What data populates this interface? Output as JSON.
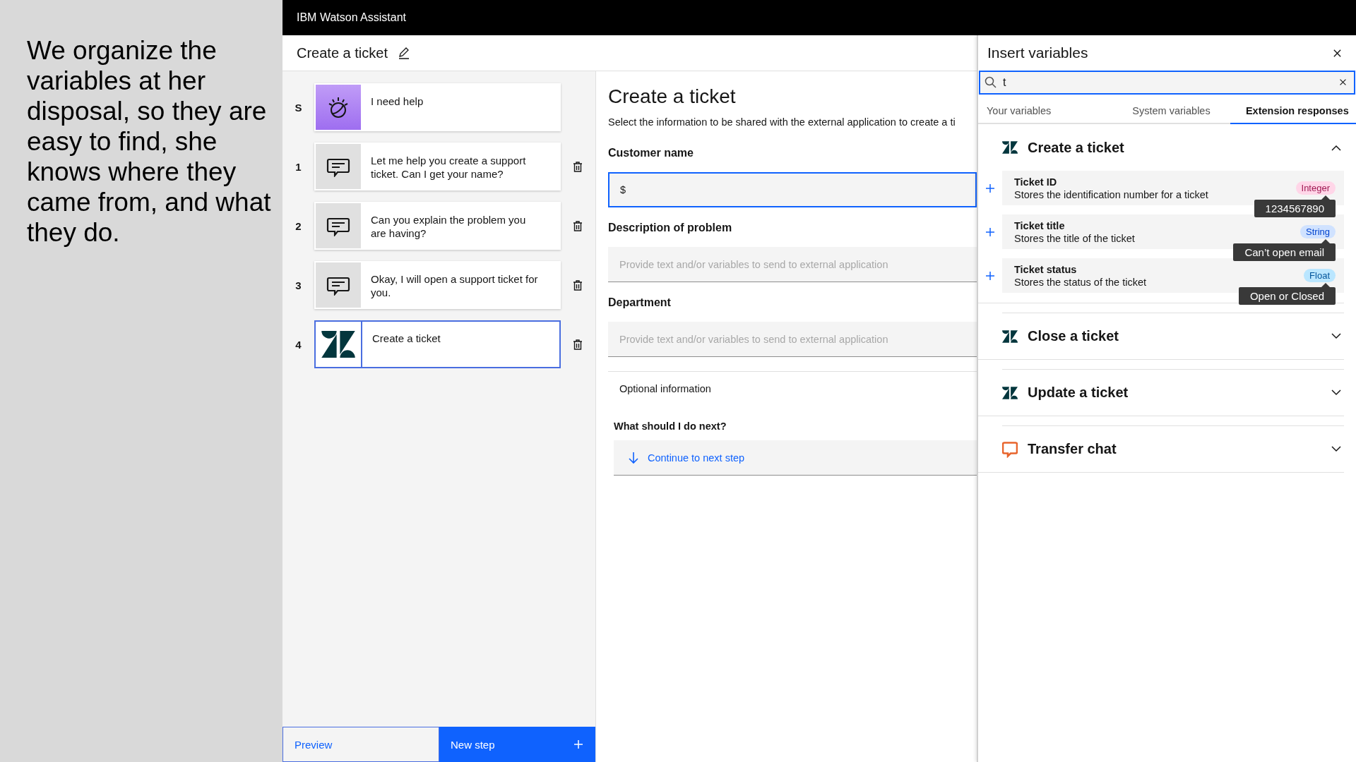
{
  "caption": "We organize the variables at her disposal, so they are easy to find, she knows where they came from, and what they do.",
  "app_bar": {
    "title": "IBM Watson Assistant"
  },
  "action_header": {
    "title": "Create a ticket"
  },
  "steps": [
    {
      "marker": "S",
      "kind": "trigger",
      "text": "I need help",
      "selected": false
    },
    {
      "marker": "1",
      "kind": "message",
      "text": "Let me help you create a support ticket. Can I get your name?",
      "selected": false
    },
    {
      "marker": "2",
      "kind": "message",
      "text": "Can you explain the problem you are having?",
      "selected": false
    },
    {
      "marker": "3",
      "kind": "message",
      "text": "Okay, I will open a support ticket for you.",
      "selected": false
    },
    {
      "marker": "4",
      "kind": "extension",
      "text": "Create a ticket",
      "selected": true
    }
  ],
  "footer": {
    "preview": "Preview",
    "new_step": "New step"
  },
  "editor": {
    "title": "Create a ticket",
    "description": "Select the information to be shared with the external application to create a ti",
    "fields": [
      {
        "label": "Customer name",
        "value": "$",
        "focused": true
      },
      {
        "label": "Description of problem",
        "placeholder": "Provide text and/or variables to send to external application",
        "focused": false
      },
      {
        "label": "Department",
        "placeholder": "Provide text and/or variables to send to external application",
        "focused": false
      }
    ],
    "optional": "Optional information",
    "next_label": "What should I do next?",
    "next_action": "Continue to next step"
  },
  "variables_panel": {
    "title": "Insert variables",
    "search": {
      "value": "t"
    },
    "tabs": [
      {
        "label": "Your variables",
        "selected": false
      },
      {
        "label": "System variables",
        "selected": false
      },
      {
        "label": "Extension responses",
        "selected": true
      }
    ],
    "groups": [
      {
        "title": "Create a ticket",
        "kind": "zendesk",
        "expanded": true,
        "variables": [
          {
            "name": "Ticket ID",
            "description": "Stores the identification number for a ticket",
            "type": "Integer",
            "color": "#ffd6e8",
            "tooltip": "1234567890"
          },
          {
            "name": "Ticket title",
            "description": "Stores the title of the ticket",
            "type": "String",
            "color": "#d0e2ff",
            "tooltip": "Can’t open email"
          },
          {
            "name": "Ticket status",
            "description": "Stores the status of the ticket",
            "type": "Float",
            "color": "#bae6ff",
            "tooltip": "Open or Closed"
          }
        ]
      },
      {
        "title": "Close a ticket",
        "kind": "zendesk",
        "expanded": false
      },
      {
        "title": "Update a ticket",
        "kind": "zendesk",
        "expanded": false
      },
      {
        "title": "Transfer chat",
        "kind": "chat",
        "expanded": false
      }
    ]
  }
}
